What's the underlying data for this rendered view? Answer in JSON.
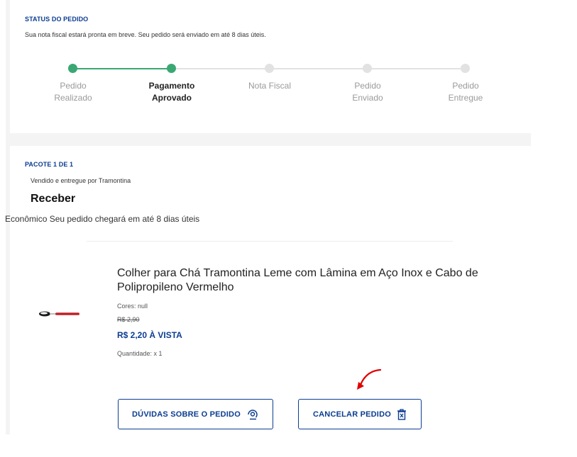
{
  "status_section": {
    "heading": "STATUS DO PEDIDO",
    "note": "Sua nota fiscal estará pronta em breve. Seu pedido será enviado em até 8 dias úteis.",
    "steps": [
      {
        "label": "Pedido\nRealizado",
        "state": "done"
      },
      {
        "label": "Pagamento\nAprovado",
        "state": "current"
      },
      {
        "label": "Nota Fiscal",
        "state": "pending"
      },
      {
        "label": "Pedido\nEnviado",
        "state": "pending"
      },
      {
        "label": "Pedido\nEntregue",
        "state": "pending"
      }
    ]
  },
  "package": {
    "heading": "PACOTE 1 DE 1",
    "seller": "Vendido e entregue por Tramontina",
    "delivery_type": "Receber",
    "delivery_note": "Econômico Seu pedido chegará em até 8 dias úteis",
    "product": {
      "title": "Colher para Chá Tramontina Leme com Lâmina em Aço Inox e Cabo de Polipropileno Vermelho",
      "colors": "Cores: null",
      "old_price": "R$ 2,90",
      "price": "R$ 2,20 À VISTA",
      "quantity": "Quantidade: x 1",
      "image_icon": "spoon-icon"
    },
    "buttons": {
      "questions": "DÚVIDAS SOBRE O PEDIDO",
      "cancel": "CANCELAR PEDIDO"
    }
  },
  "colors": {
    "accent": "#0b3d91",
    "done": "#3aa873",
    "pending": "#e2e2e2",
    "annotation_arrow": "#e00000"
  }
}
